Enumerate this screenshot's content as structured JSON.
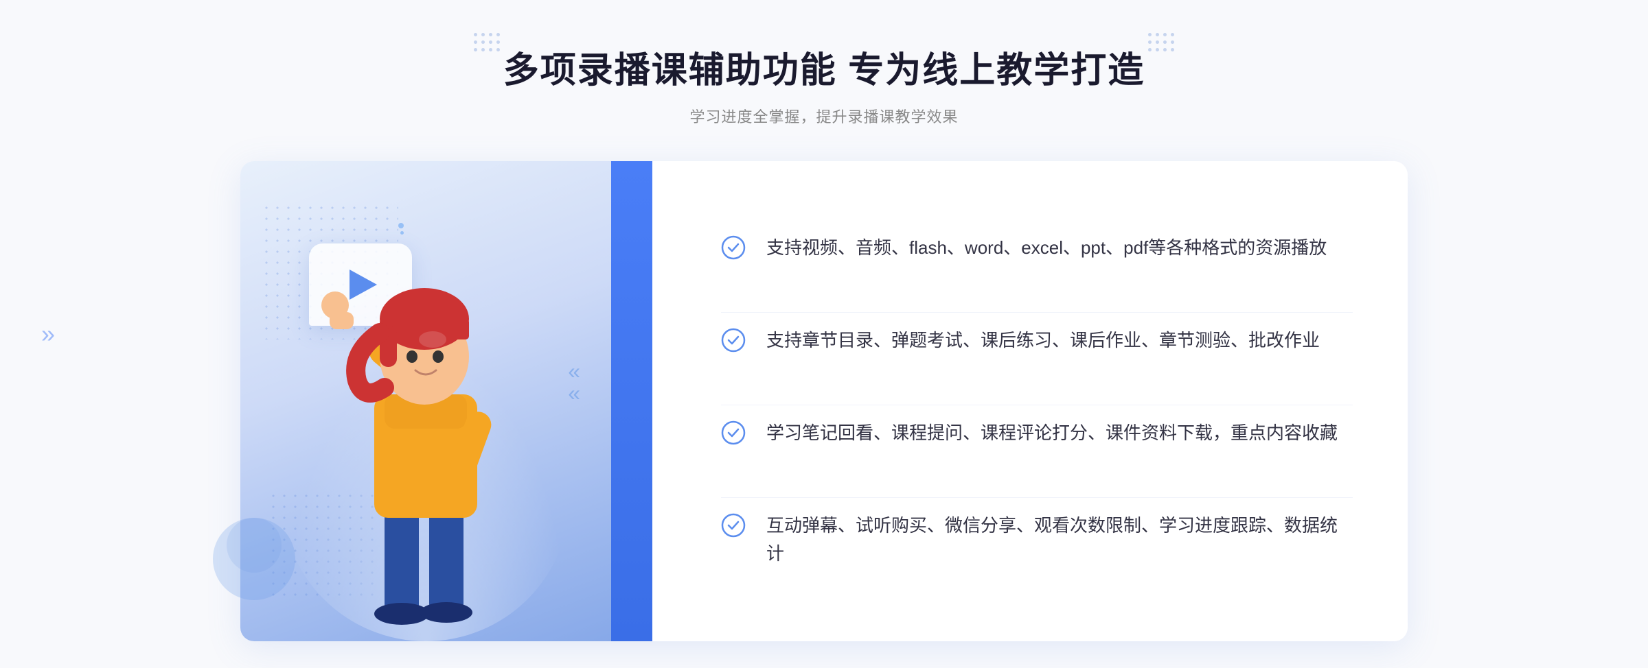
{
  "header": {
    "main_title": "多项录播课辅助功能 专为线上教学打造",
    "sub_title": "学习进度全掌握，提升录播课教学效果"
  },
  "features": [
    {
      "id": "feature-1",
      "text": "支持视频、音频、flash、word、excel、ppt、pdf等各种格式的资源播放"
    },
    {
      "id": "feature-2",
      "text": "支持章节目录、弹题考试、课后练习、课后作业、章节测验、批改作业"
    },
    {
      "id": "feature-3",
      "text": "学习笔记回看、课程提问、课程评论打分、课件资料下载，重点内容收藏"
    },
    {
      "id": "feature-4",
      "text": "互动弹幕、试听购买、微信分享、观看次数限制、学习进度跟踪、数据统计"
    }
  ],
  "colors": {
    "accent_blue": "#4a7ef7",
    "light_blue": "#85a7e8",
    "check_color": "#5b8dee",
    "text_dark": "#333344",
    "text_gray": "#888888",
    "background": "#f8f9fc"
  },
  "icons": {
    "check": "check-circle-icon",
    "play": "play-icon",
    "chevron_left": "«",
    "chevron_right": "»"
  }
}
